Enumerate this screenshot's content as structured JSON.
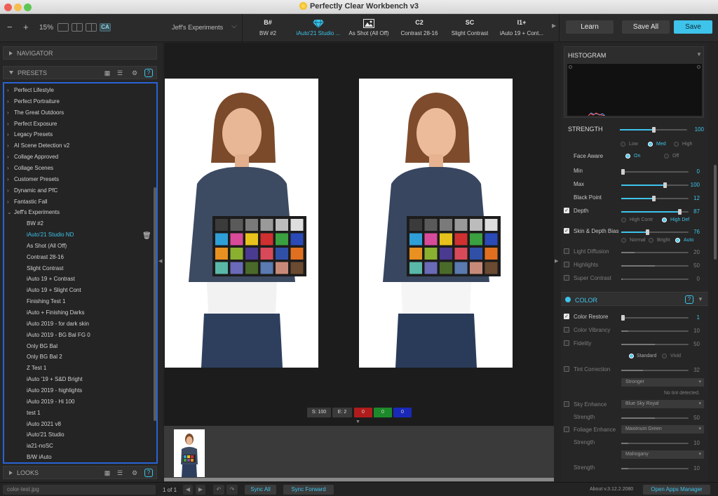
{
  "app": {
    "title": "Perfectly Clear Workbench v3"
  },
  "toolbar": {
    "zoom": "15%",
    "ca_label": "CA",
    "preset_group": "Jeff's Experiments",
    "tabs": [
      {
        "abbr": "B#",
        "name": "BW #2"
      },
      {
        "abbr": "",
        "name": "iAuto'21 Studio ..."
      },
      {
        "abbr": "",
        "name": "As Shot (All Off)"
      },
      {
        "abbr": "C2",
        "name": "Contrast 28-16"
      },
      {
        "abbr": "SC",
        "name": "Slight Contrast"
      },
      {
        "abbr": "I1+",
        "name": "iAuto 19 + Cont..."
      }
    ],
    "learn": "Learn",
    "save_all": "Save All",
    "save": "Save"
  },
  "left": {
    "navigator": "NAVIGATOR",
    "presets": "PRESETS",
    "looks": "LOOKS",
    "groups": [
      "Perfect Lifestyle",
      "Perfect Portraiture",
      "The Great Outdoors",
      "Perfect Exposure",
      "Legacy Presets",
      "AI Scene Detection v2",
      "Collage Approved",
      "Collage Scenes",
      "Customer Presets",
      "Dynamic and PfC",
      "Fantastic Fall",
      "Jeff's Experiments"
    ],
    "items": [
      "BW #2",
      "iAuto'21 Studio ND",
      "As Shot (All Off)",
      "Contrast 28-16",
      "Slight Contrast",
      "iAuto 19 + Contrast",
      "iAuto 19 + Slight Cont",
      "Finishing Test 1",
      "iAuto + Finishing Darks",
      "iAuto 2019 - for dark skin",
      "iAuto 2019 - BG Bal FG 0",
      "Only BG Bal",
      "Only BG Bal 2",
      "Z Test 1",
      "iAuto '19 + S&D Bright",
      "iAuto 2019 - highlights",
      "iAuto 2019 - Hi 100",
      "test 1",
      "iAuto 2021 v8",
      "iAuto'21 Studio",
      "ia21-noSC",
      "B/W iAuto"
    ]
  },
  "center": {
    "stats": {
      "s": "S: 100",
      "e": "E: 2",
      "r": "0",
      "g": "0",
      "b": "0"
    }
  },
  "right": {
    "histogram": "HISTOGRAM",
    "strength_label": "STRENGTH",
    "strength": 100,
    "low": "Low",
    "med": "Med",
    "high": "High",
    "face_aware": "Face Aware",
    "on": "On",
    "off": "Off",
    "sliders": [
      {
        "label": "Min",
        "value": 0
      },
      {
        "label": "Max",
        "value": 100
      },
      {
        "label": "Black Point",
        "value": 12
      },
      {
        "label": "Depth",
        "value": 87
      },
      {
        "label": "Skin & Depth Bias",
        "value": 76
      },
      {
        "label": "Light Diffusion",
        "value": 20
      },
      {
        "label": "Highlights",
        "value": 50
      },
      {
        "label": "Super Contrast",
        "value": 0
      }
    ],
    "high_contr": "High Contr",
    "high_def": "High Def",
    "normal": "Normal",
    "bright": "Bright",
    "auto": "Auto",
    "color_section": "COLOR",
    "color": [
      {
        "label": "Color Restore",
        "value": 1
      },
      {
        "label": "Color Vibrancy",
        "value": 10
      },
      {
        "label": "Fidelity",
        "value": 50
      },
      {
        "label": "Tint Correction",
        "value": 32
      }
    ],
    "standard": "Standard",
    "vivid": "Vivid",
    "tint_mode": "Stronger",
    "no_tint": "No tint detected.",
    "sky_enhance": "Sky Enhance",
    "sky_option": "Blue Sky Royal",
    "sky_strength_label": "Strength",
    "sky_strength": 50,
    "foliage_enhance": "Foliage Enhance",
    "foliage_option": "Maximum Green",
    "foliage_strength_label": "Strength",
    "foliage_strength": 10,
    "skin_option": "Mahogany",
    "skin_strength_label": "Strength",
    "skin_strength": 10
  },
  "status": {
    "file": "color-test.jpg",
    "page": "1 of 1",
    "sync_all": "Sync All",
    "sync_forward": "Sync Forward",
    "version": "About v.3.12.2.2080",
    "open_apps": "Open Apps Manager"
  }
}
